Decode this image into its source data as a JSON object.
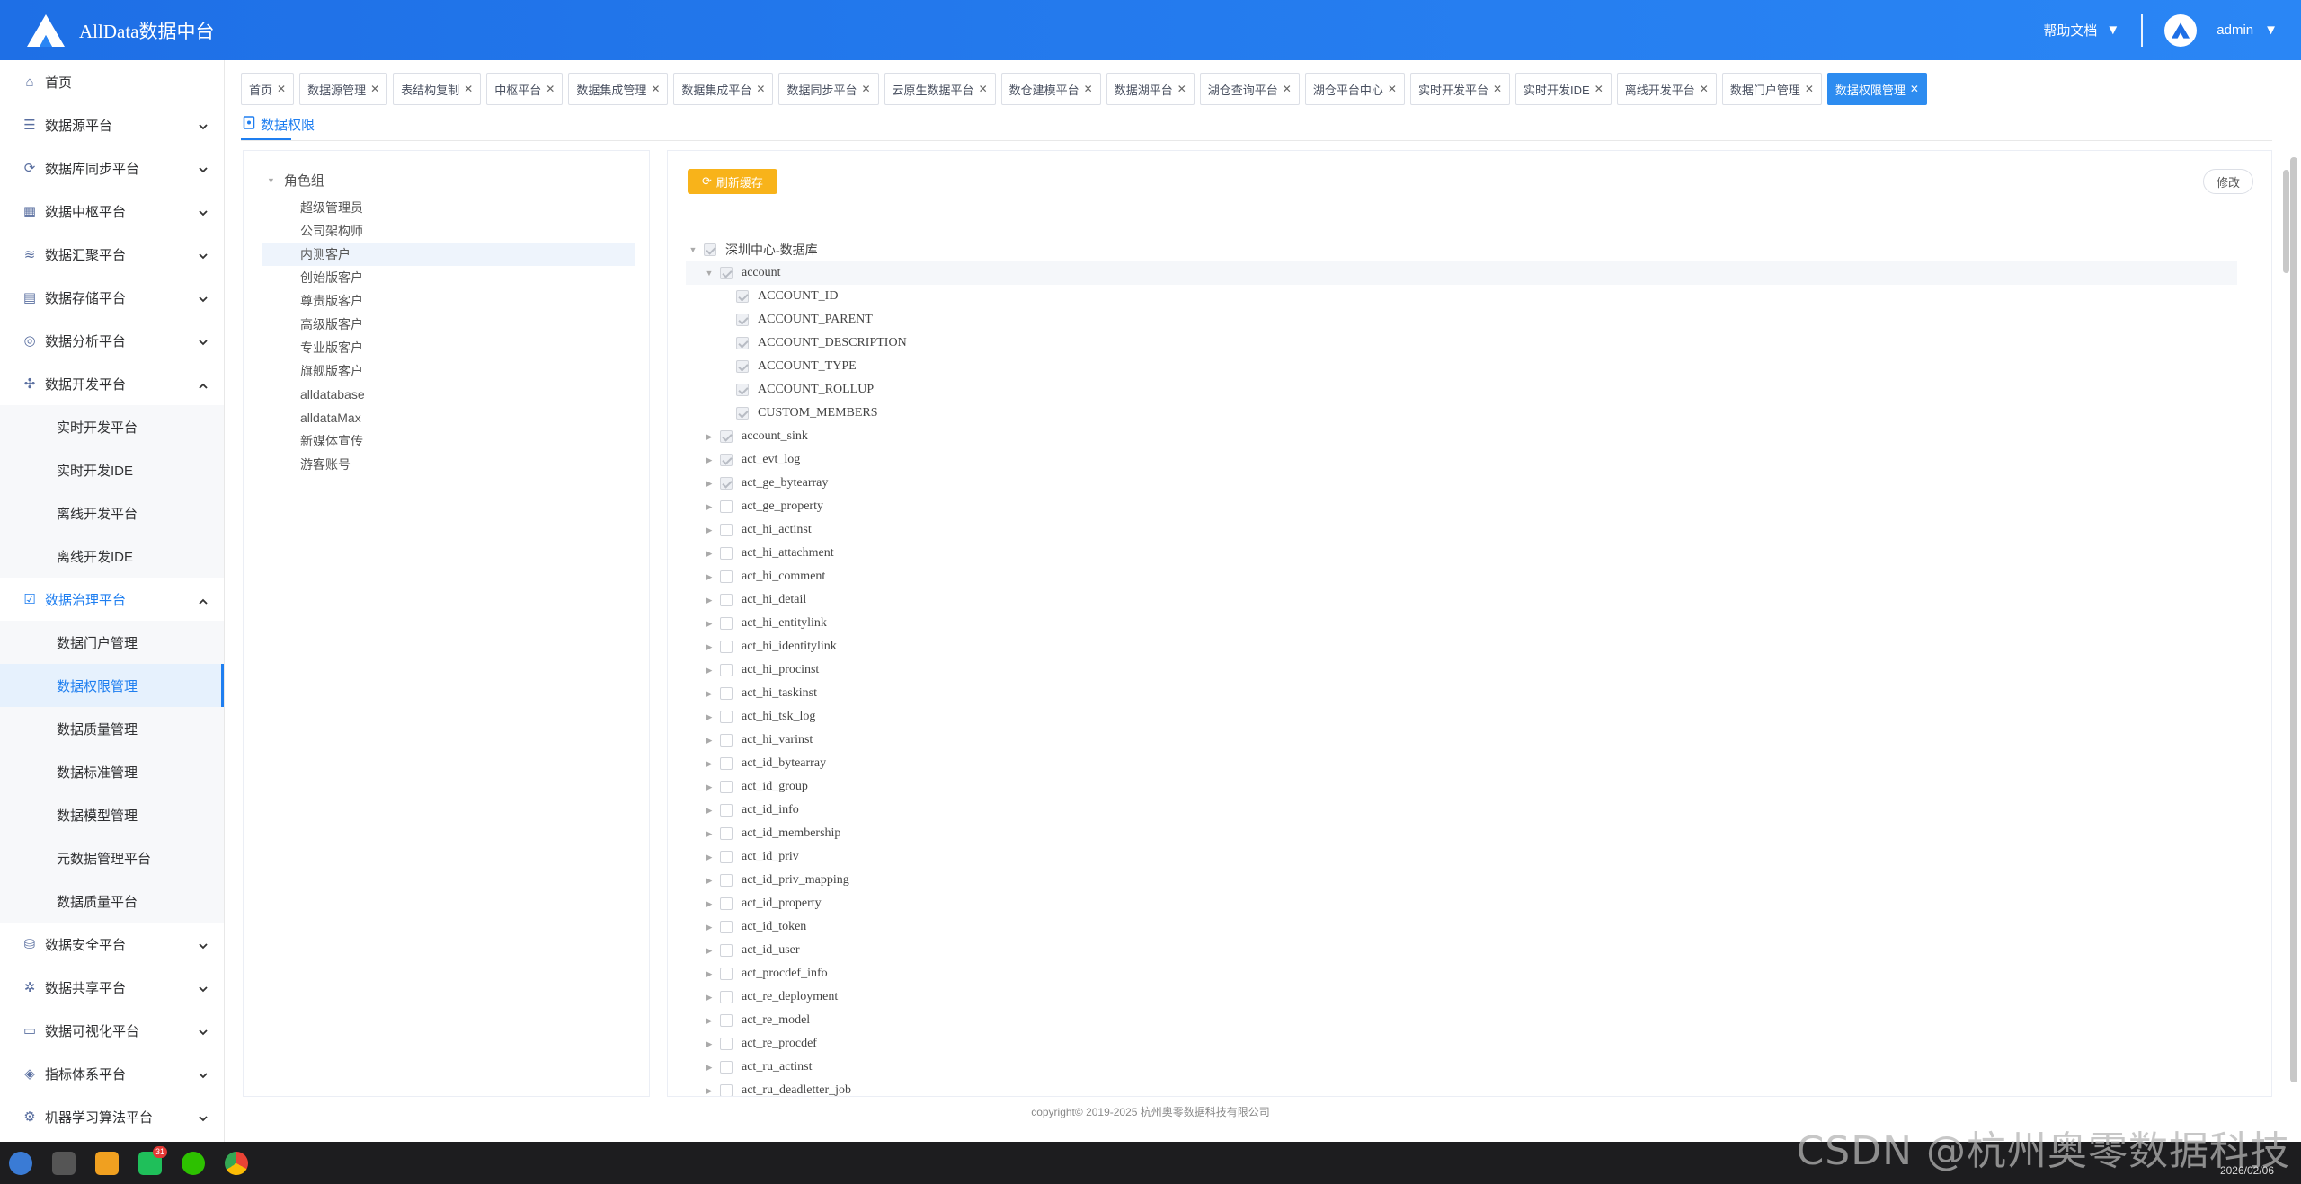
{
  "header": {
    "app_title": "AllData数据中台",
    "help_label": "帮助文档",
    "user_name": "admin"
  },
  "sidebar": {
    "items": [
      {
        "label": "首页",
        "icon": "home-icon",
        "expandable": false
      },
      {
        "label": "数据源平台",
        "icon": "database-icon",
        "expandable": true
      },
      {
        "label": "数据库同步平台",
        "icon": "sync-icon",
        "expandable": true
      },
      {
        "label": "数据中枢平台",
        "icon": "grid-icon",
        "expandable": true
      },
      {
        "label": "数据汇聚平台",
        "icon": "stack-icon",
        "expandable": true
      },
      {
        "label": "数据存储平台",
        "icon": "storage-icon",
        "expandable": true
      },
      {
        "label": "数据分析平台",
        "icon": "analysis-icon",
        "expandable": true
      },
      {
        "label": "数据开发平台",
        "icon": "dev-icon",
        "expandable": true,
        "expanded": true,
        "children": [
          "实时开发平台",
          "实时开发IDE",
          "离线开发平台",
          "离线开发IDE"
        ]
      },
      {
        "label": "数据治理平台",
        "icon": "governance-icon",
        "expandable": true,
        "expanded": true,
        "active": true,
        "children": [
          "数据门户管理",
          "数据权限管理",
          "数据质量管理",
          "数据标准管理",
          "数据模型管理",
          "元数据管理平台",
          "数据质量平台"
        ]
      },
      {
        "label": "数据安全平台",
        "icon": "security-icon",
        "expandable": true
      },
      {
        "label": "数据共享平台",
        "icon": "share-icon",
        "expandable": true
      },
      {
        "label": "数据可视化平台",
        "icon": "monitor-icon",
        "expandable": true
      },
      {
        "label": "指标体系平台",
        "icon": "cube-icon",
        "expandable": true
      },
      {
        "label": "机器学习算法平台",
        "icon": "ml-icon",
        "expandable": true
      }
    ],
    "active_child": "数据权限管理"
  },
  "tags": [
    {
      "label": "首页"
    },
    {
      "label": "数据源管理"
    },
    {
      "label": "表结构复制"
    },
    {
      "label": "中枢平台"
    },
    {
      "label": "数据集成管理"
    },
    {
      "label": "数据集成平台"
    },
    {
      "label": "数据同步平台"
    },
    {
      "label": "云原生数据平台"
    },
    {
      "label": "数仓建模平台"
    },
    {
      "label": "数据湖平台"
    },
    {
      "label": "湖仓查询平台"
    },
    {
      "label": "湖仓平台中心"
    },
    {
      "label": "实时开发平台"
    },
    {
      "label": "实时开发IDE"
    },
    {
      "label": "离线开发平台"
    },
    {
      "label": "数据门户管理"
    },
    {
      "label": "数据权限管理",
      "active": true
    }
  ],
  "page_tab": "数据权限",
  "role_tree": {
    "root": "角色组",
    "roles": [
      "超级管理员",
      "公司架构师",
      "内测客户",
      "创始版客户",
      "尊贵版客户",
      "高级版客户",
      "专业版客户",
      "旗舰版客户",
      "alldatabase",
      "alldataMax",
      "新媒体宣传",
      "游客账号"
    ],
    "selected": "内测客户"
  },
  "toolbar": {
    "refresh_label": "刷新缓存",
    "edit_label": "修改"
  },
  "db_tree": {
    "root": "深圳中心-数据库",
    "expanded_table": "account",
    "columns": [
      "ACCOUNT_ID",
      "ACCOUNT_PARENT",
      "ACCOUNT_DESCRIPTION",
      "ACCOUNT_TYPE",
      "ACCOUNT_ROLLUP",
      "CUSTOM_MEMBERS"
    ],
    "tables": [
      {
        "name": "account_sink",
        "checked": true
      },
      {
        "name": "act_evt_log",
        "checked": true
      },
      {
        "name": "act_ge_bytearray",
        "checked": true
      },
      {
        "name": "act_ge_property",
        "checked": false
      },
      {
        "name": "act_hi_actinst",
        "checked": false
      },
      {
        "name": "act_hi_attachment",
        "checked": false
      },
      {
        "name": "act_hi_comment",
        "checked": false
      },
      {
        "name": "act_hi_detail",
        "checked": false
      },
      {
        "name": "act_hi_entitylink",
        "checked": false
      },
      {
        "name": "act_hi_identitylink",
        "checked": false
      },
      {
        "name": "act_hi_procinst",
        "checked": false
      },
      {
        "name": "act_hi_taskinst",
        "checked": false
      },
      {
        "name": "act_hi_tsk_log",
        "checked": false
      },
      {
        "name": "act_hi_varinst",
        "checked": false
      },
      {
        "name": "act_id_bytearray",
        "checked": false
      },
      {
        "name": "act_id_group",
        "checked": false
      },
      {
        "name": "act_id_info",
        "checked": false
      },
      {
        "name": "act_id_membership",
        "checked": false
      },
      {
        "name": "act_id_priv",
        "checked": false
      },
      {
        "name": "act_id_priv_mapping",
        "checked": false
      },
      {
        "name": "act_id_property",
        "checked": false
      },
      {
        "name": "act_id_token",
        "checked": false
      },
      {
        "name": "act_id_user",
        "checked": false
      },
      {
        "name": "act_procdef_info",
        "checked": false
      },
      {
        "name": "act_re_deployment",
        "checked": false
      },
      {
        "name": "act_re_model",
        "checked": false
      },
      {
        "name": "act_re_procdef",
        "checked": false
      },
      {
        "name": "act_ru_actinst",
        "checked": false
      },
      {
        "name": "act_ru_deadletter_job",
        "checked": false
      }
    ]
  },
  "footer": "copyright© 2019-2025 杭州奥零数据科技有限公司",
  "taskbar": {
    "badge_count": "31",
    "date": "2026/02/06",
    "watermark": "CSDN @杭州奥零数据科技"
  },
  "colors": {
    "primary": "#1e7ef0",
    "header": "#2a86f5",
    "refresh": "#f8b31a",
    "active_tag": "#2d8cf0"
  }
}
